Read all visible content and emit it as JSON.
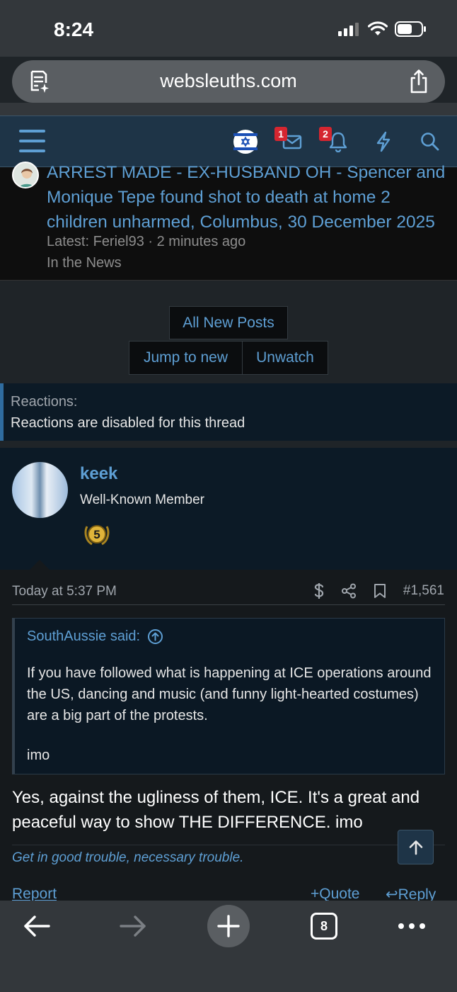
{
  "status_bar": {
    "time": "8:24"
  },
  "browser": {
    "url": "websleuths.com"
  },
  "nav": {
    "inbox_count": "1",
    "alerts_count": "2"
  },
  "news": {
    "title": "ARREST MADE - EX-HUSBAND OH - Spencer and Monique Tepe found shot to death at home 2 children unharmed, Columbus, 30 December 2025",
    "latest": "Latest: Feriel93 · 2 minutes ago",
    "forum": "In the News"
  },
  "buttons": {
    "all_new_posts": "All New Posts",
    "jump_to_new": "Jump to new",
    "unwatch": "Unwatch"
  },
  "reactions": {
    "label": "Reactions:",
    "text": "Reactions are disabled for this thread"
  },
  "post": {
    "username": "keek",
    "user_title": "Well-Known Member",
    "medal_number": "5",
    "date": "Today at 5:37 PM",
    "post_number": "#1,561",
    "quote_author": "SouthAussie said:",
    "quote_text": "If you have followed what is happening at ICE operations around the US, dancing and music (and funny light-hearted costumes) are a big part of the protests.",
    "quote_imo": "imo",
    "body": "Yes, against the ugliness of them, ICE. It's a great and peaceful way to show THE DIFFERENCE. imo",
    "signature": "Get in good trouble, necessary trouble.",
    "report": "Report",
    "quote": "Quote",
    "reply": "Reply"
  },
  "toolbar": {
    "tab_count": "8"
  }
}
